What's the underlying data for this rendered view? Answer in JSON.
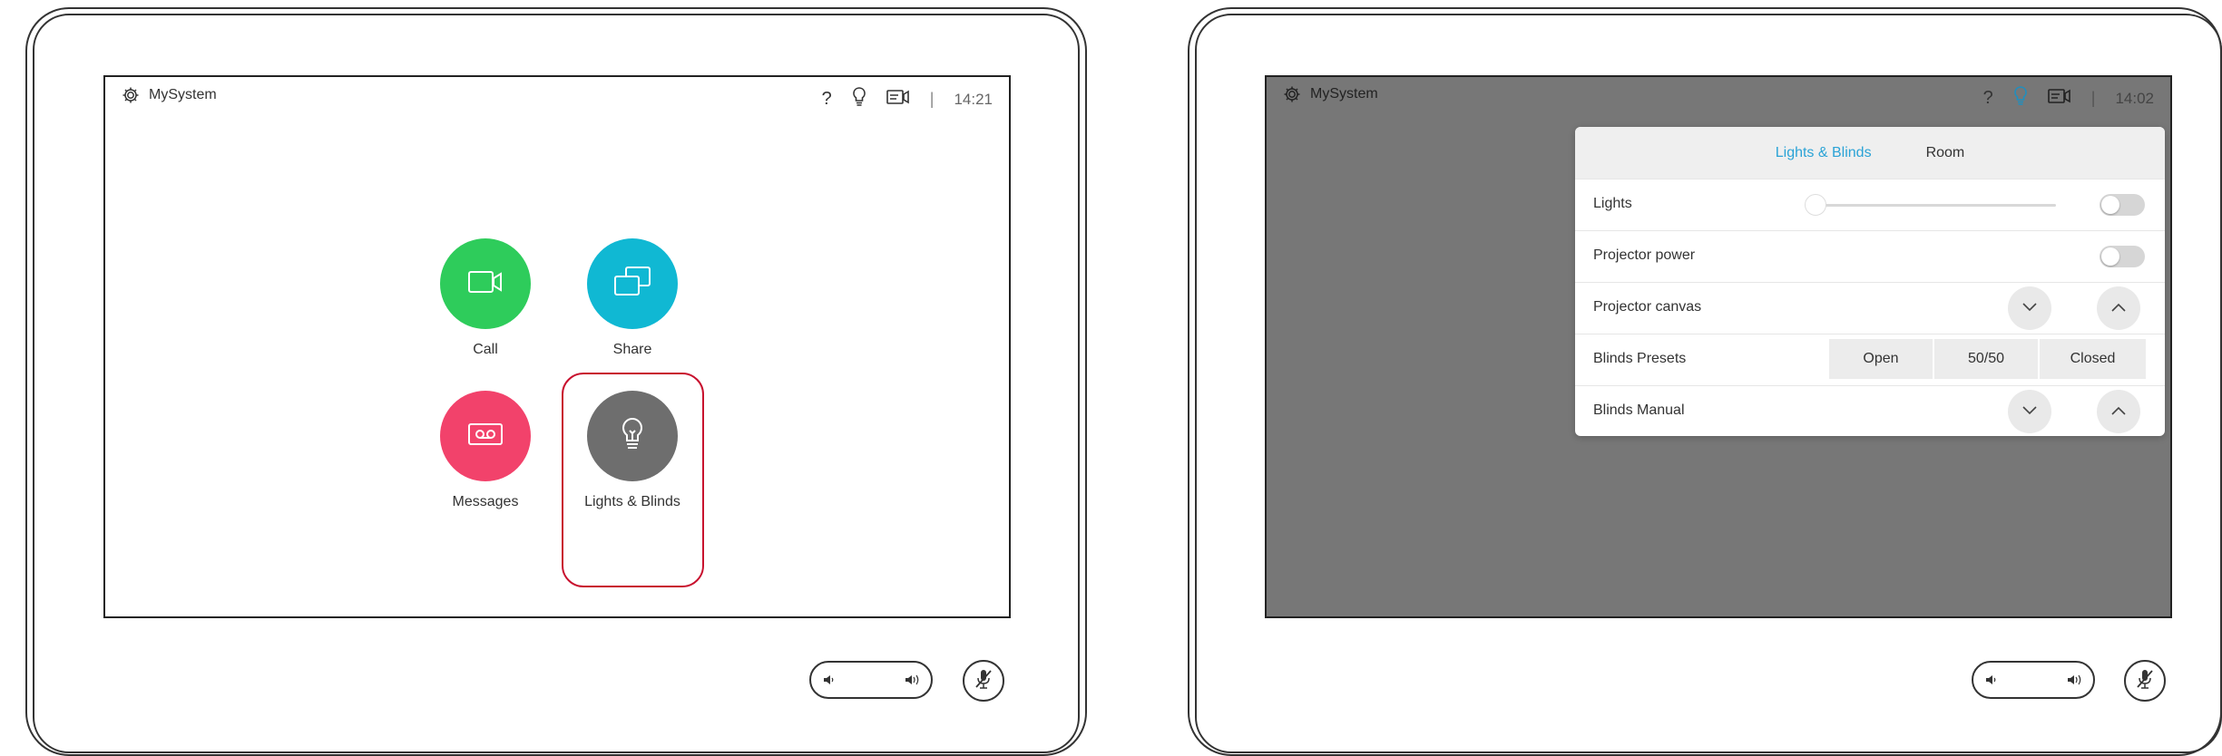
{
  "left_device": {
    "topbar": {
      "system_name": "MySystem",
      "clock": "14:21",
      "separator": "|"
    },
    "tiles": {
      "call": {
        "label": "Call",
        "color": "#2ecc5b"
      },
      "share": {
        "label": "Share",
        "color": "#10b8d3"
      },
      "messages": {
        "label": "Messages",
        "color": "#f2426b"
      },
      "lights": {
        "label": "Lights & Blinds",
        "color": "#6e6e6e"
      }
    },
    "highlight_color": "#c8102e"
  },
  "right_device": {
    "topbar": {
      "system_name": "MySystem",
      "clock": "14:02",
      "separator": "|"
    },
    "tabs": [
      {
        "label": "Lights & Blinds",
        "active": true
      },
      {
        "label": "Room",
        "active": false
      }
    ],
    "rows": {
      "lights": {
        "label": "Lights",
        "toggle_on": false,
        "slider_value": 0
      },
      "projector_power": {
        "label": "Projector power",
        "toggle_on": false
      },
      "projector_canvas": {
        "label": "Projector canvas"
      },
      "blinds_presets": {
        "label": "Blinds Presets",
        "options": [
          "Open",
          "50/50",
          "Closed"
        ]
      },
      "blinds_manual": {
        "label": "Blinds Manual"
      }
    },
    "accent_color": "#2ba3d6",
    "overlay_color": "#777777"
  }
}
